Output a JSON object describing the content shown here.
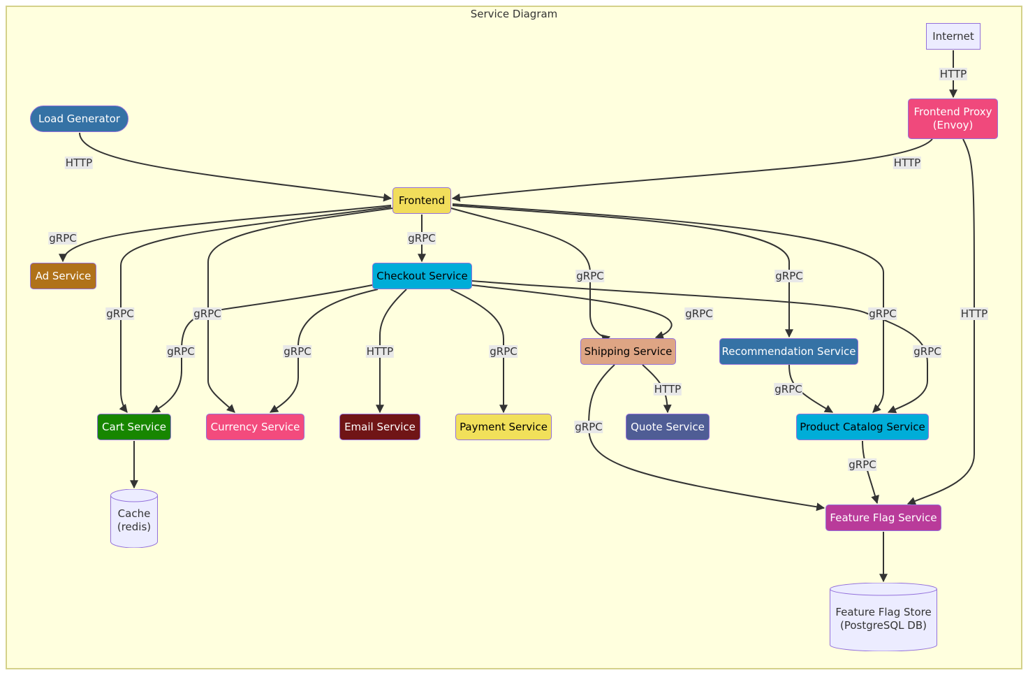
{
  "title": "Service Diagram",
  "colors": {
    "background": "#ffffde",
    "frame_border": "#d4d18a",
    "edge": "#333333",
    "edge_label_bg": "#e8e8e8"
  },
  "nodes": {
    "internet": {
      "label": "Internet",
      "shape": "rect",
      "fill": "#ececff",
      "text": "#333333"
    },
    "frontend_proxy": {
      "label": "Frontend Proxy\n(Envoy)",
      "shape": "round",
      "fill": "#f0497c",
      "text": "#ffffff"
    },
    "load_generator": {
      "label": "Load Generator",
      "shape": "stadium",
      "fill": "#3572a5",
      "text": "#ffffff"
    },
    "frontend": {
      "label": "Frontend",
      "shape": "round",
      "fill": "#f1dd5b",
      "text": "#000000"
    },
    "ad_service": {
      "label": "Ad Service",
      "shape": "round",
      "fill": "#b07219",
      "text": "#ffffff"
    },
    "checkout_service": {
      "label": "Checkout Service",
      "shape": "round",
      "fill": "#00add8",
      "text": "#000000"
    },
    "shipping_service": {
      "label": "Shipping Service",
      "shape": "round",
      "fill": "#dea584",
      "text": "#000000"
    },
    "recommendation_service": {
      "label": "Recommendation Service",
      "shape": "round",
      "fill": "#3572a5",
      "text": "#ffffff"
    },
    "cart_service": {
      "label": "Cart Service",
      "shape": "round",
      "fill": "#178600",
      "text": "#ffffff"
    },
    "currency_service": {
      "label": "Currency Service",
      "shape": "round",
      "fill": "#f34b7d",
      "text": "#ffffff"
    },
    "email_service": {
      "label": "Email Service",
      "shape": "round",
      "fill": "#701516",
      "text": "#ffffff"
    },
    "payment_service": {
      "label": "Payment Service",
      "shape": "round",
      "fill": "#f1e05a",
      "text": "#000000"
    },
    "quote_service": {
      "label": "Quote Service",
      "shape": "round",
      "fill": "#4f5d95",
      "text": "#ffffff"
    },
    "product_catalog_service": {
      "label": "Product Catalog Service",
      "shape": "round",
      "fill": "#00add8",
      "text": "#000000"
    },
    "cache": {
      "label": "Cache\n(redis)",
      "shape": "cylinder",
      "fill": "#ececff",
      "text": "#333333"
    },
    "feature_flag_service": {
      "label": "Feature Flag Service",
      "shape": "round",
      "fill": "#b93b9a",
      "text": "#ffffff"
    },
    "feature_flag_store": {
      "label": "Feature Flag Store\n(PostgreSQL DB)",
      "shape": "cylinder",
      "fill": "#ececff",
      "text": "#333333"
    }
  },
  "edges": [
    {
      "from": "internet",
      "to": "frontend_proxy",
      "label": "HTTP"
    },
    {
      "from": "load_generator",
      "to": "frontend",
      "label": "HTTP"
    },
    {
      "from": "frontend_proxy",
      "to": "frontend",
      "label": "HTTP"
    },
    {
      "from": "frontend_proxy",
      "to": "feature_flag_service",
      "label": "HTTP"
    },
    {
      "from": "frontend",
      "to": "ad_service",
      "label": "gRPC"
    },
    {
      "from": "frontend",
      "to": "cart_service",
      "label": "gRPC"
    },
    {
      "from": "frontend",
      "to": "currency_service",
      "label": "gRPC"
    },
    {
      "from": "frontend",
      "to": "checkout_service",
      "label": "gRPC"
    },
    {
      "from": "frontend",
      "to": "shipping_service",
      "label": "gRPC"
    },
    {
      "from": "frontend",
      "to": "recommendation_service",
      "label": "gRPC"
    },
    {
      "from": "frontend",
      "to": "product_catalog_service",
      "label": "gRPC"
    },
    {
      "from": "checkout_service",
      "to": "cart_service",
      "label": "gRPC"
    },
    {
      "from": "checkout_service",
      "to": "currency_service",
      "label": "gRPC"
    },
    {
      "from": "checkout_service",
      "to": "email_service",
      "label": "HTTP"
    },
    {
      "from": "checkout_service",
      "to": "payment_service",
      "label": "gRPC"
    },
    {
      "from": "checkout_service",
      "to": "shipping_service",
      "label": "gRPC"
    },
    {
      "from": "checkout_service",
      "to": "product_catalog_service",
      "label": "gRPC"
    },
    {
      "from": "shipping_service",
      "to": "quote_service",
      "label": "HTTP"
    },
    {
      "from": "shipping_service",
      "to": "feature_flag_service",
      "label": "gRPC"
    },
    {
      "from": "recommendation_service",
      "to": "product_catalog_service",
      "label": "gRPC"
    },
    {
      "from": "product_catalog_service",
      "to": "feature_flag_service",
      "label": "gRPC"
    },
    {
      "from": "cart_service",
      "to": "cache",
      "label": ""
    },
    {
      "from": "feature_flag_service",
      "to": "feature_flag_store",
      "label": ""
    }
  ]
}
